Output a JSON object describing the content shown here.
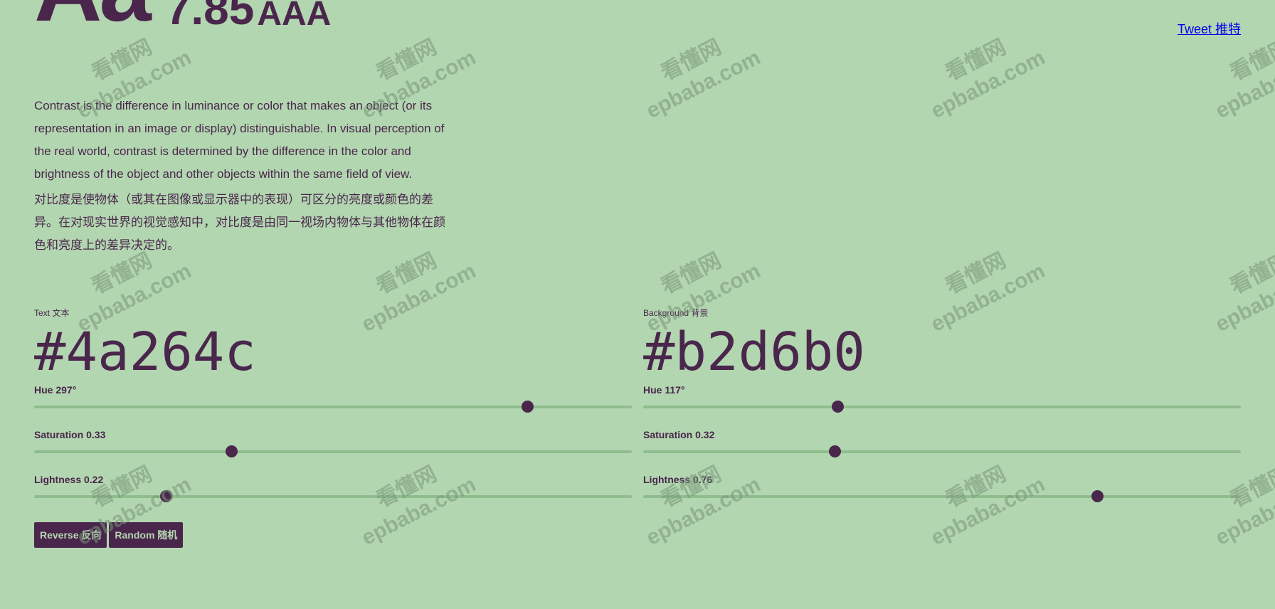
{
  "hero": {
    "sample": "Aa",
    "ratio": "7.85",
    "level": "AAA"
  },
  "tweet_label": "Tweet 推特",
  "description": {
    "en": "Contrast is the difference in luminance or color that makes an object (or its representation in an image or display) distinguishable. In visual perception of the real world, contrast is determined by the difference in the color and brightness of the object and other objects within the same field of view.",
    "cn": "对比度是使物体（或其在图像或显示器中的表现）可区分的亮度或颜色的差异。在对现实世界的视觉感知中，对比度是由同一视场内物体与其他物体在颜色和亮度上的差异决定的。"
  },
  "text_color": {
    "label": "Text 文本",
    "hex": "#4a264c",
    "hue_label": "Hue 297°",
    "hue": 297,
    "saturation_label": "Saturation 0.33",
    "saturation": 0.33,
    "lightness_label": "Lightness 0.22",
    "lightness": 0.22
  },
  "background_color": {
    "label": "Background 背景",
    "hex": "#b2d6b0",
    "hue_label": "Hue 117°",
    "hue": 117,
    "saturation_label": "Saturation 0.32",
    "saturation": 0.32,
    "lightness_label": "Lightness 0.76",
    "lightness": 0.76
  },
  "buttons": {
    "reverse": "Reverse 反向",
    "random": "Random 随机"
  },
  "colors": {
    "foreground": "#4a264c",
    "background": "#b2d6b0",
    "track": "#8fbd8d",
    "link": "#0000ee"
  },
  "watermark": {
    "line1": "看懂网",
    "line2": "epbaba.com"
  }
}
